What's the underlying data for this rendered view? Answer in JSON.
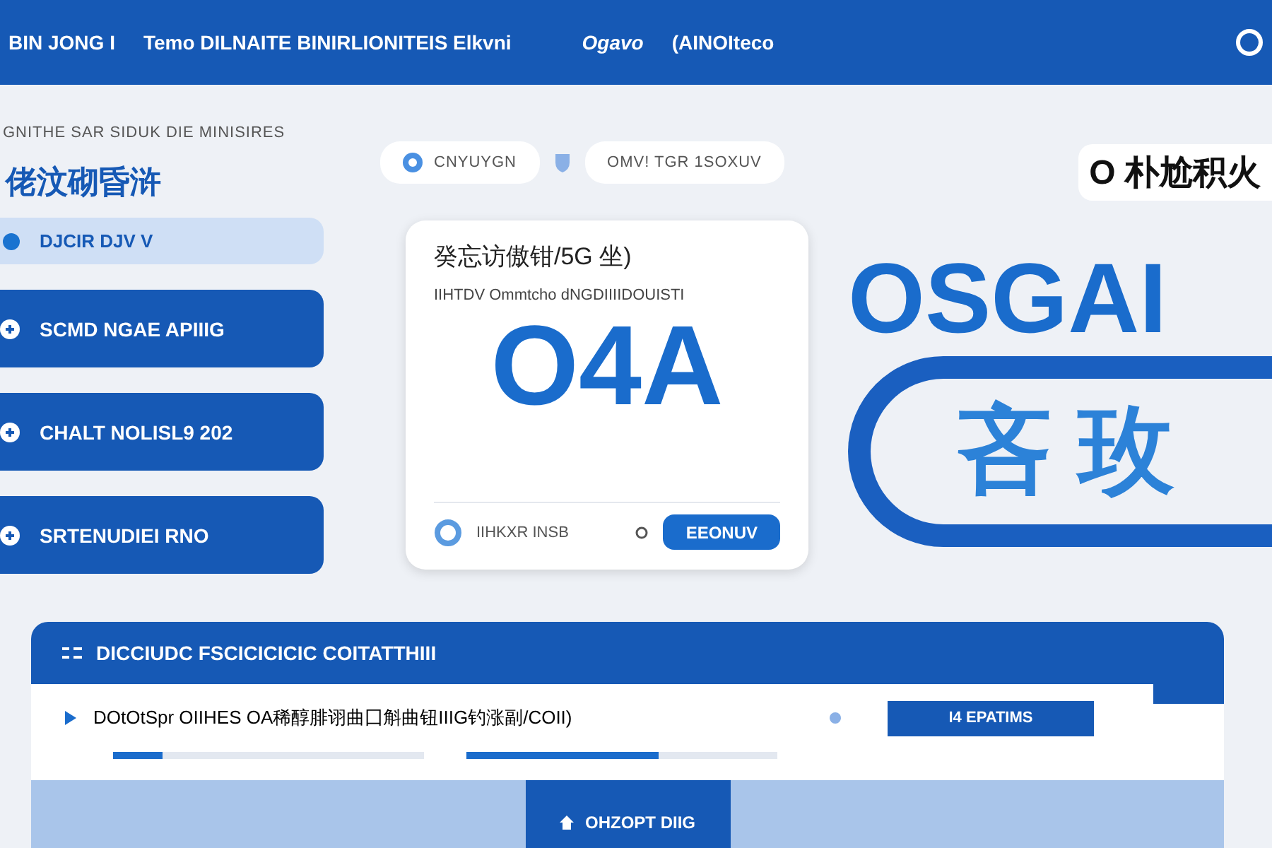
{
  "top_bar": {
    "items": [
      "BIN JONG I",
      "Temo DILNAITE BINIRLIONITEIS Elkvni",
      "Ogavo",
      "(AINOIteco"
    ]
  },
  "sidebar": {
    "caption": "GNITHE SAR SIDUK DIE MINISIRES",
    "title": "佬汶砌昏浒",
    "items": [
      {
        "label": "DJCIR DJV  V",
        "selected": true
      },
      {
        "label": "SCMD NGAE APIIIG",
        "selected": false
      },
      {
        "label": "CHALT NOLISL9 202",
        "selected": false
      },
      {
        "label": "SRTENUDIEI RNO",
        "selected": false
      }
    ]
  },
  "filters": [
    {
      "label": "CNYUYGN"
    },
    {
      "label": "OMV!  TGR 1SOXUV"
    }
  ],
  "corner_label": "O 朴尬积火",
  "card": {
    "title": "癸忘访傲钳/5G 坐)",
    "subtitle": "IIHTDV Ommtcho dNGDIIIIDOUISTI",
    "value": "O4A",
    "footer": "IIHKXR INSB",
    "button": "EEONUV"
  },
  "hero": {
    "headline": "OSGAI",
    "glyphs": "吝 玫"
  },
  "panel": {
    "title": "DICCIUDC FSCICICICIC COITATTHIII",
    "row": {
      "text": "DOtOtSpr OIIHES OA稀醇腓诩曲囗斛曲钮IIIG钓涨副/COII)",
      "button": "I4 EPATIMS"
    },
    "progress": [
      {
        "level": 0.16
      },
      {
        "level": 0.62
      }
    ],
    "action": "OHZOPT DIIG"
  }
}
